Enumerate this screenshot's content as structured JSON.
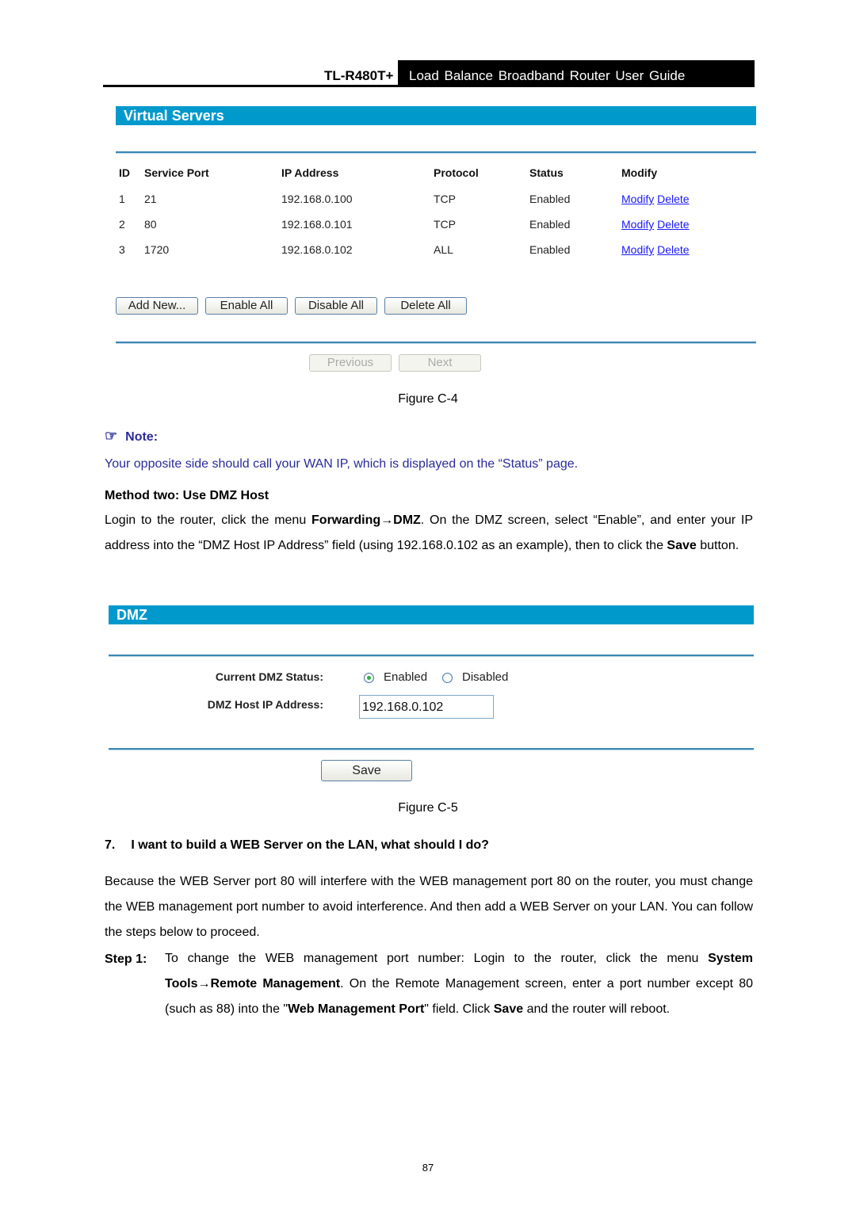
{
  "header": {
    "model": "TL-R480T+",
    "title": "Load Balance Broadband Router User Guide"
  },
  "virtual_servers": {
    "title": "Virtual Servers",
    "columns": [
      "ID",
      "Service Port",
      "IP Address",
      "Protocol",
      "Status",
      "Modify"
    ],
    "rows": [
      {
        "id": "1",
        "service_port": "21",
        "ip": "192.168.0.100",
        "protocol": "TCP",
        "status": "Enabled",
        "modify": "Modify",
        "delete": "Delete"
      },
      {
        "id": "2",
        "service_port": "80",
        "ip": "192.168.0.101",
        "protocol": "TCP",
        "status": "Enabled",
        "modify": "Modify",
        "delete": "Delete"
      },
      {
        "id": "3",
        "service_port": "1720",
        "ip": "192.168.0.102",
        "protocol": "ALL",
        "status": "Enabled",
        "modify": "Modify",
        "delete": "Delete"
      }
    ],
    "buttons": {
      "add_new": "Add New...",
      "enable_all": "Enable All",
      "disable_all": "Disable All",
      "delete_all": "Delete All",
      "previous": "Previous",
      "next": "Next"
    },
    "link_color": "#1a1aff"
  },
  "figure_c4": "Figure C-4",
  "note": {
    "icon": "pointing-hand-icon",
    "label": "Note:",
    "text": "Your opposite side should call your WAN IP, which is displayed on the “Status” page.",
    "color": "#2b2b9a"
  },
  "method_two": {
    "heading": "Method two: Use DMZ Host",
    "p1_a": "Login to the router, click the menu ",
    "p1_b": "Forwarding",
    "p1_arrow": "→",
    "p1_c": "DMZ",
    "p1_d": ". On the DMZ screen, select “Enable”, and enter your IP address into the “DMZ Host IP Address” field (using 192.168.0.102 as an example), then to click the ",
    "p1_e": "Save",
    "p1_f": " button."
  },
  "dmz": {
    "title": "DMZ",
    "status_label": "Current DMZ Status:",
    "enabled_label": "Enabled",
    "disabled_label": "Disabled",
    "status_selected": "Enabled",
    "host_ip_label": "DMZ Host IP Address:",
    "host_ip_value": "192.168.0.102",
    "save_label": "Save",
    "bar_color": "#0099cc"
  },
  "figure_c5": "Figure C-5",
  "section7": {
    "heading_num": "7.",
    "heading": "I want to build a WEB Server on the LAN, what should I do?",
    "para": "Because the WEB Server port 80 will interfere with the WEB management port 80 on the router, you must change the WEB management port number to avoid interference. And then add a WEB Server on your LAN. You can follow the steps below to proceed.",
    "step1_label": "Step 1:",
    "step1_a": "To change the WEB management port number: Login to the router, click the menu ",
    "step1_b": "System Tools",
    "step1_arrow": "→",
    "step1_c": "Remote Management",
    "step1_d": ". On the Remote Management screen, enter a port number except 80 (such as 88) into the \"",
    "step1_e": "Web Management Port",
    "step1_f": "\" field. Click ",
    "step1_g": "Save",
    "step1_h": " and the router will reboot."
  },
  "page_number": "87"
}
